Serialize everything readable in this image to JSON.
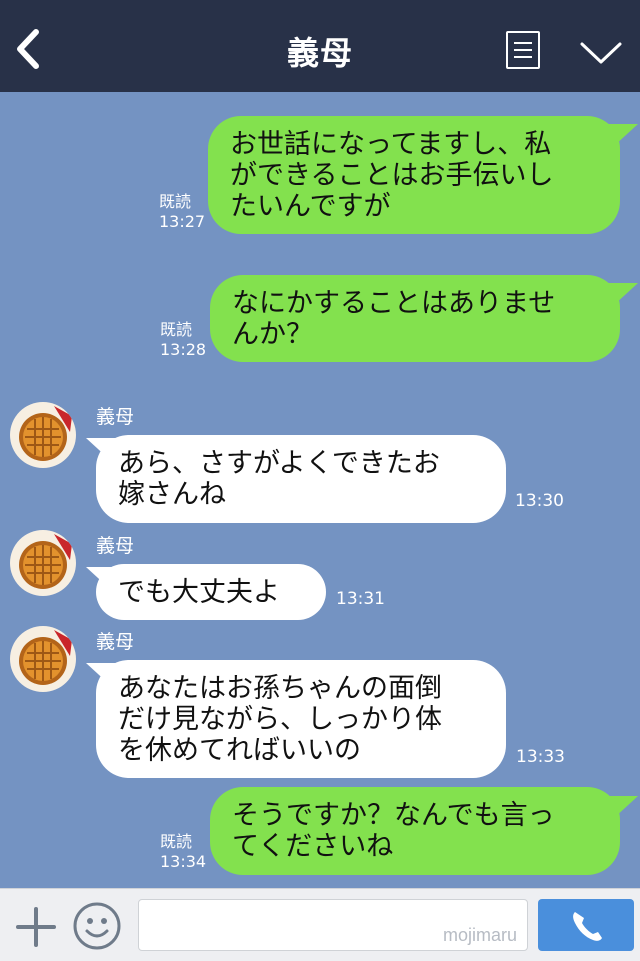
{
  "header": {
    "title": "義母"
  },
  "messages": [
    {
      "side": "out",
      "text": "お世話になってますし、私\nができることはお手伝いし\nたいんですが",
      "read": "既読",
      "time": "13:27"
    },
    {
      "side": "out",
      "text": "なにかすることはありませ\nんか？",
      "read": "既読",
      "time": "13:28"
    },
    {
      "side": "in",
      "sender": "義母",
      "text": "あら、さすがよくできたお\n嫁さんね",
      "time": "13:30"
    },
    {
      "side": "in",
      "sender": "義母",
      "text": "でも大丈夫よ",
      "time": "13:31"
    },
    {
      "side": "in",
      "sender": "義母",
      "text": "あなたはお孫ちゃんの面倒\nだけ見ながら、しっかり体\nを休めてればいいの",
      "time": "13:33"
    },
    {
      "side": "out",
      "text": "そうですか？なんでも言っ\nてくださいね",
      "read": "既読",
      "time": "13:34"
    }
  ],
  "footer": {
    "watermark": "mojimaru"
  },
  "colors": {
    "header": "#283148",
    "chat_bg": "#7493c2",
    "outgoing": "#83e14e",
    "incoming": "#ffffff",
    "call": "#4a8fdc"
  },
  "icons": [
    "back-chevron-icon",
    "notes-icon",
    "chevron-down-icon",
    "plus-icon",
    "emoji-icon",
    "phone-icon"
  ]
}
